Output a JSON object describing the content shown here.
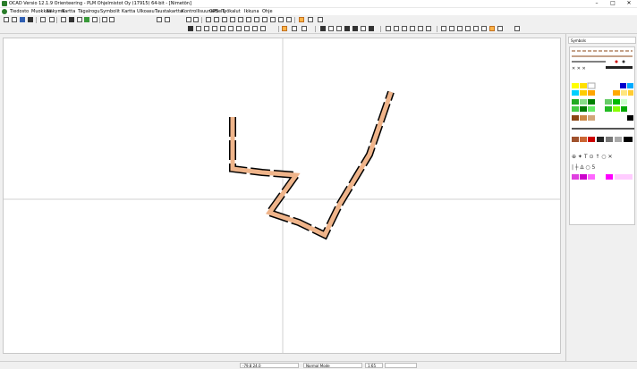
{
  "window": {
    "title": "OCAD Versio 12.1.9 Orienteering - PLM Ohjelmistot Oy (17915) 64-bit - [Nimetön]",
    "minimize_glyph": "–",
    "maximize_glyph": "□",
    "close_glyph": "✕"
  },
  "menu": {
    "items": [
      "Tiedosto",
      "Muokkaa",
      "Näkymä",
      "Kartta",
      "Tägalrogu",
      "Symbolit",
      "Kartta",
      "Ulkoasu",
      "Taustakartta",
      "Kontrollisuunnittelu",
      "GPS",
      "Työkalut",
      "Ikkuna",
      "Ohje"
    ]
  },
  "symbols_panel": {
    "header": "Symbols"
  },
  "statusbar": {
    "coords": "-79.8  24.0",
    "mode": "Normal Mode",
    "zoom": "1:65"
  },
  "colors": {
    "path_fill": "#efb48a",
    "path_stroke": "#000000",
    "canvas": "#ffffff"
  }
}
